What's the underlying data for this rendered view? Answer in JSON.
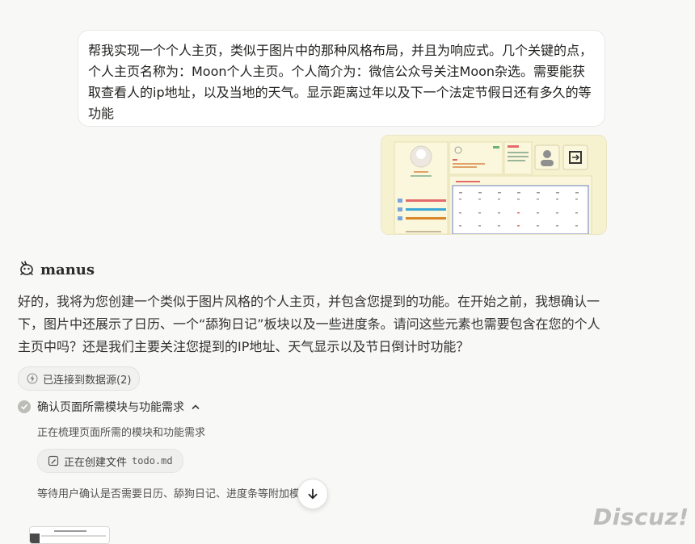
{
  "user_message": {
    "text": "帮我实现一个个人主页，类似于图片中的那种风格布局，并且为响应式。几个关键的点，个人主页名称为：Moon个人主页。个人简介为：微信公众号关注Moon杂选。需要能获取查看人的ip地址，以及当地的天气。显示距离过年以及下一个法定节假日还有多久的等功能"
  },
  "assistant": {
    "name": "manus",
    "icon": "manus-logo-icon",
    "reply": "好的，我将为您创建一个类似于图片风格的个人主页，并包含您提到的功能。在开始之前，我想确认一下，图片中还展示了日历、一个“舔狗日记”板块以及一些进度条。请问这些元素也需要包含在您的个人主页中吗？还是我们主要关注您提到的IP地址、天气显示以及节日倒计时功能？"
  },
  "source_pill": {
    "label": "已连接到数据源(2)",
    "icon": "lightning-icon"
  },
  "task": {
    "title": "确认页面所需模块与功能需求",
    "expand_icon": "chevron-up-icon",
    "step1": "正在梳理页面所需的模块和功能需求",
    "file_action": {
      "label": "正在创建文件",
      "file": "todo.md",
      "icon": "file-edit-icon"
    },
    "step2": "等待用户确认是否需要日历、舔狗日记、进度条等附加模块"
  },
  "scroll_button": {
    "icon": "arrow-down-icon"
  },
  "watermark": "Discuz!",
  "thumbnail": {
    "colors": {
      "bg": "#f6f1cf",
      "panel": "#fbf7dc",
      "red": "#e46b6b",
      "blue": "#3aa6d6",
      "orange": "#d9862a"
    }
  }
}
